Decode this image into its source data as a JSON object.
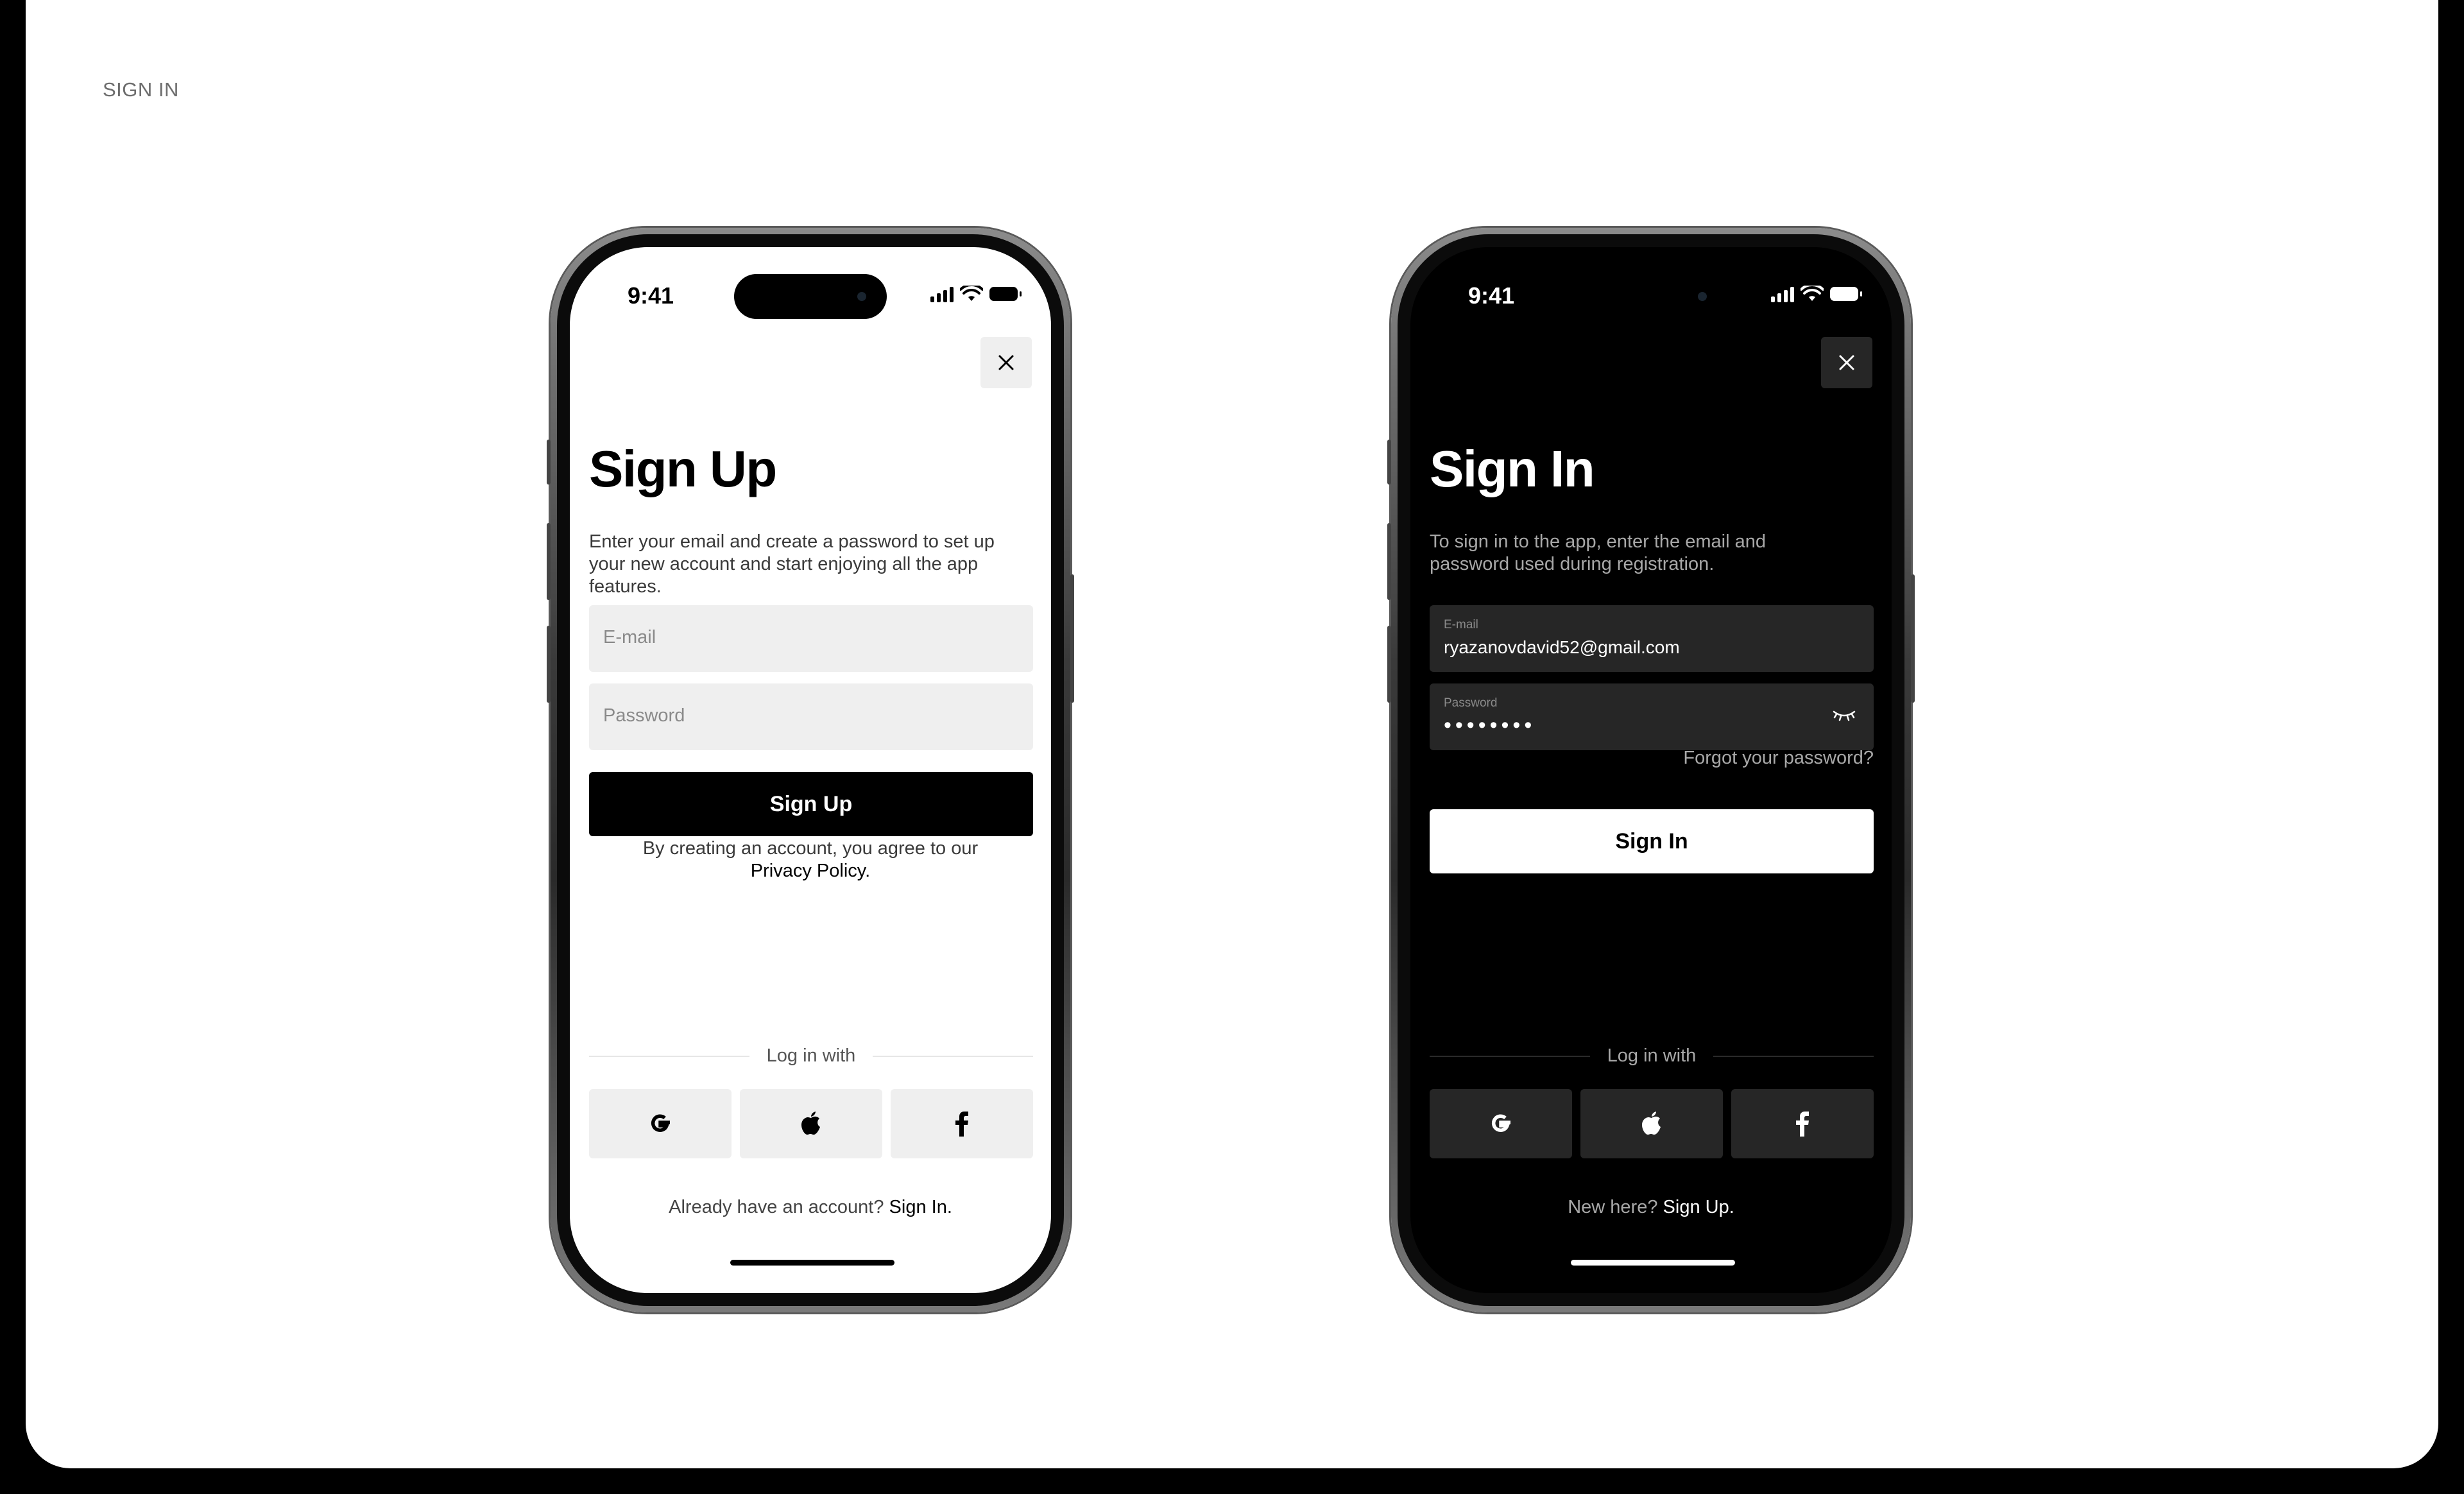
{
  "page": {
    "section_label": "SIGN IN"
  },
  "signup": {
    "status_time": "9:41",
    "title": "Sign Up",
    "subtitle": "Enter your email and create a password to set up your new account and start enjoying all the app features.",
    "email_placeholder": "E-mail",
    "password_placeholder": "Password",
    "submit_label": "Sign Up",
    "policy_text": "By creating an account, you agree to our",
    "policy_link": "Privacy Policy.",
    "divider_text": "Log in with",
    "footer_text": "Already have an account?",
    "footer_link": "Sign In."
  },
  "signin": {
    "status_time": "9:41",
    "title": "Sign In",
    "subtitle": "To sign in to the app, enter the email and password used during registration.",
    "email_label": "E-mail",
    "email_value": "ryazanovdavid52@gmail.com",
    "password_label": "Password",
    "password_value": "••••••••",
    "forgot_label": "Forgot your password?",
    "submit_label": "Sign In",
    "divider_text": "Log in with",
    "footer_text": "New here?",
    "footer_link": "Sign Up."
  },
  "social_providers": [
    "google-icon",
    "apple-icon",
    "facebook-icon"
  ],
  "colors": {
    "light_surface": "#ffffff",
    "dark_surface": "#000000",
    "field_light": "#efefef",
    "field_dark": "#262626"
  }
}
